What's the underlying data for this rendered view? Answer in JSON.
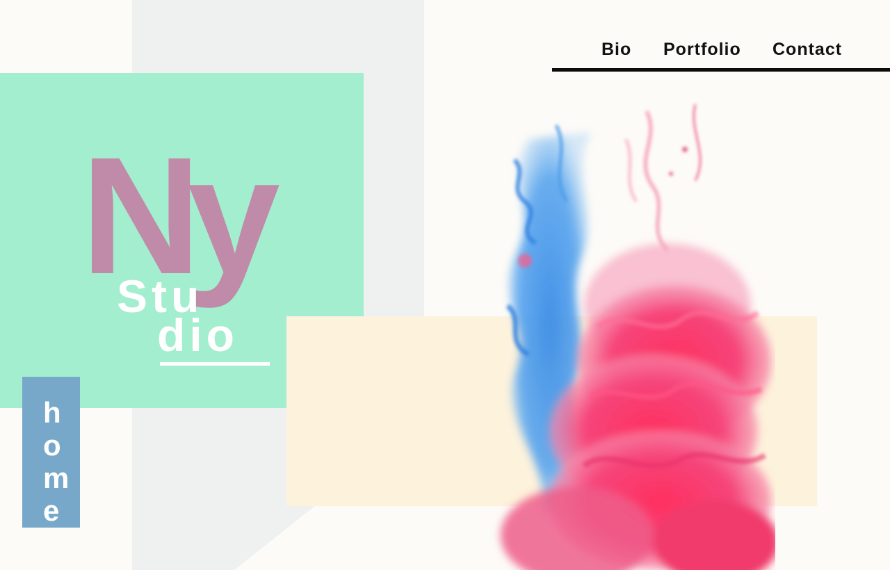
{
  "nav": {
    "bio": "Bio",
    "portfolio": "Portfolio",
    "contact": "Contact"
  },
  "logo": {
    "monogram": "Ny",
    "studio_line1": "Stu",
    "studio_line2": "dio"
  },
  "home_tab": {
    "label": "home"
  },
  "colors": {
    "mint": "#a3eece",
    "mauve": "#c08ba9",
    "cream": "#fdf2dc",
    "steel_blue": "#78a8c9",
    "grey": "#eff1f0",
    "ink_pink": "#ff3d6e",
    "ink_blue": "#3d8fe0"
  },
  "image": {
    "subject": "pink-and-blue-ink-in-water"
  }
}
